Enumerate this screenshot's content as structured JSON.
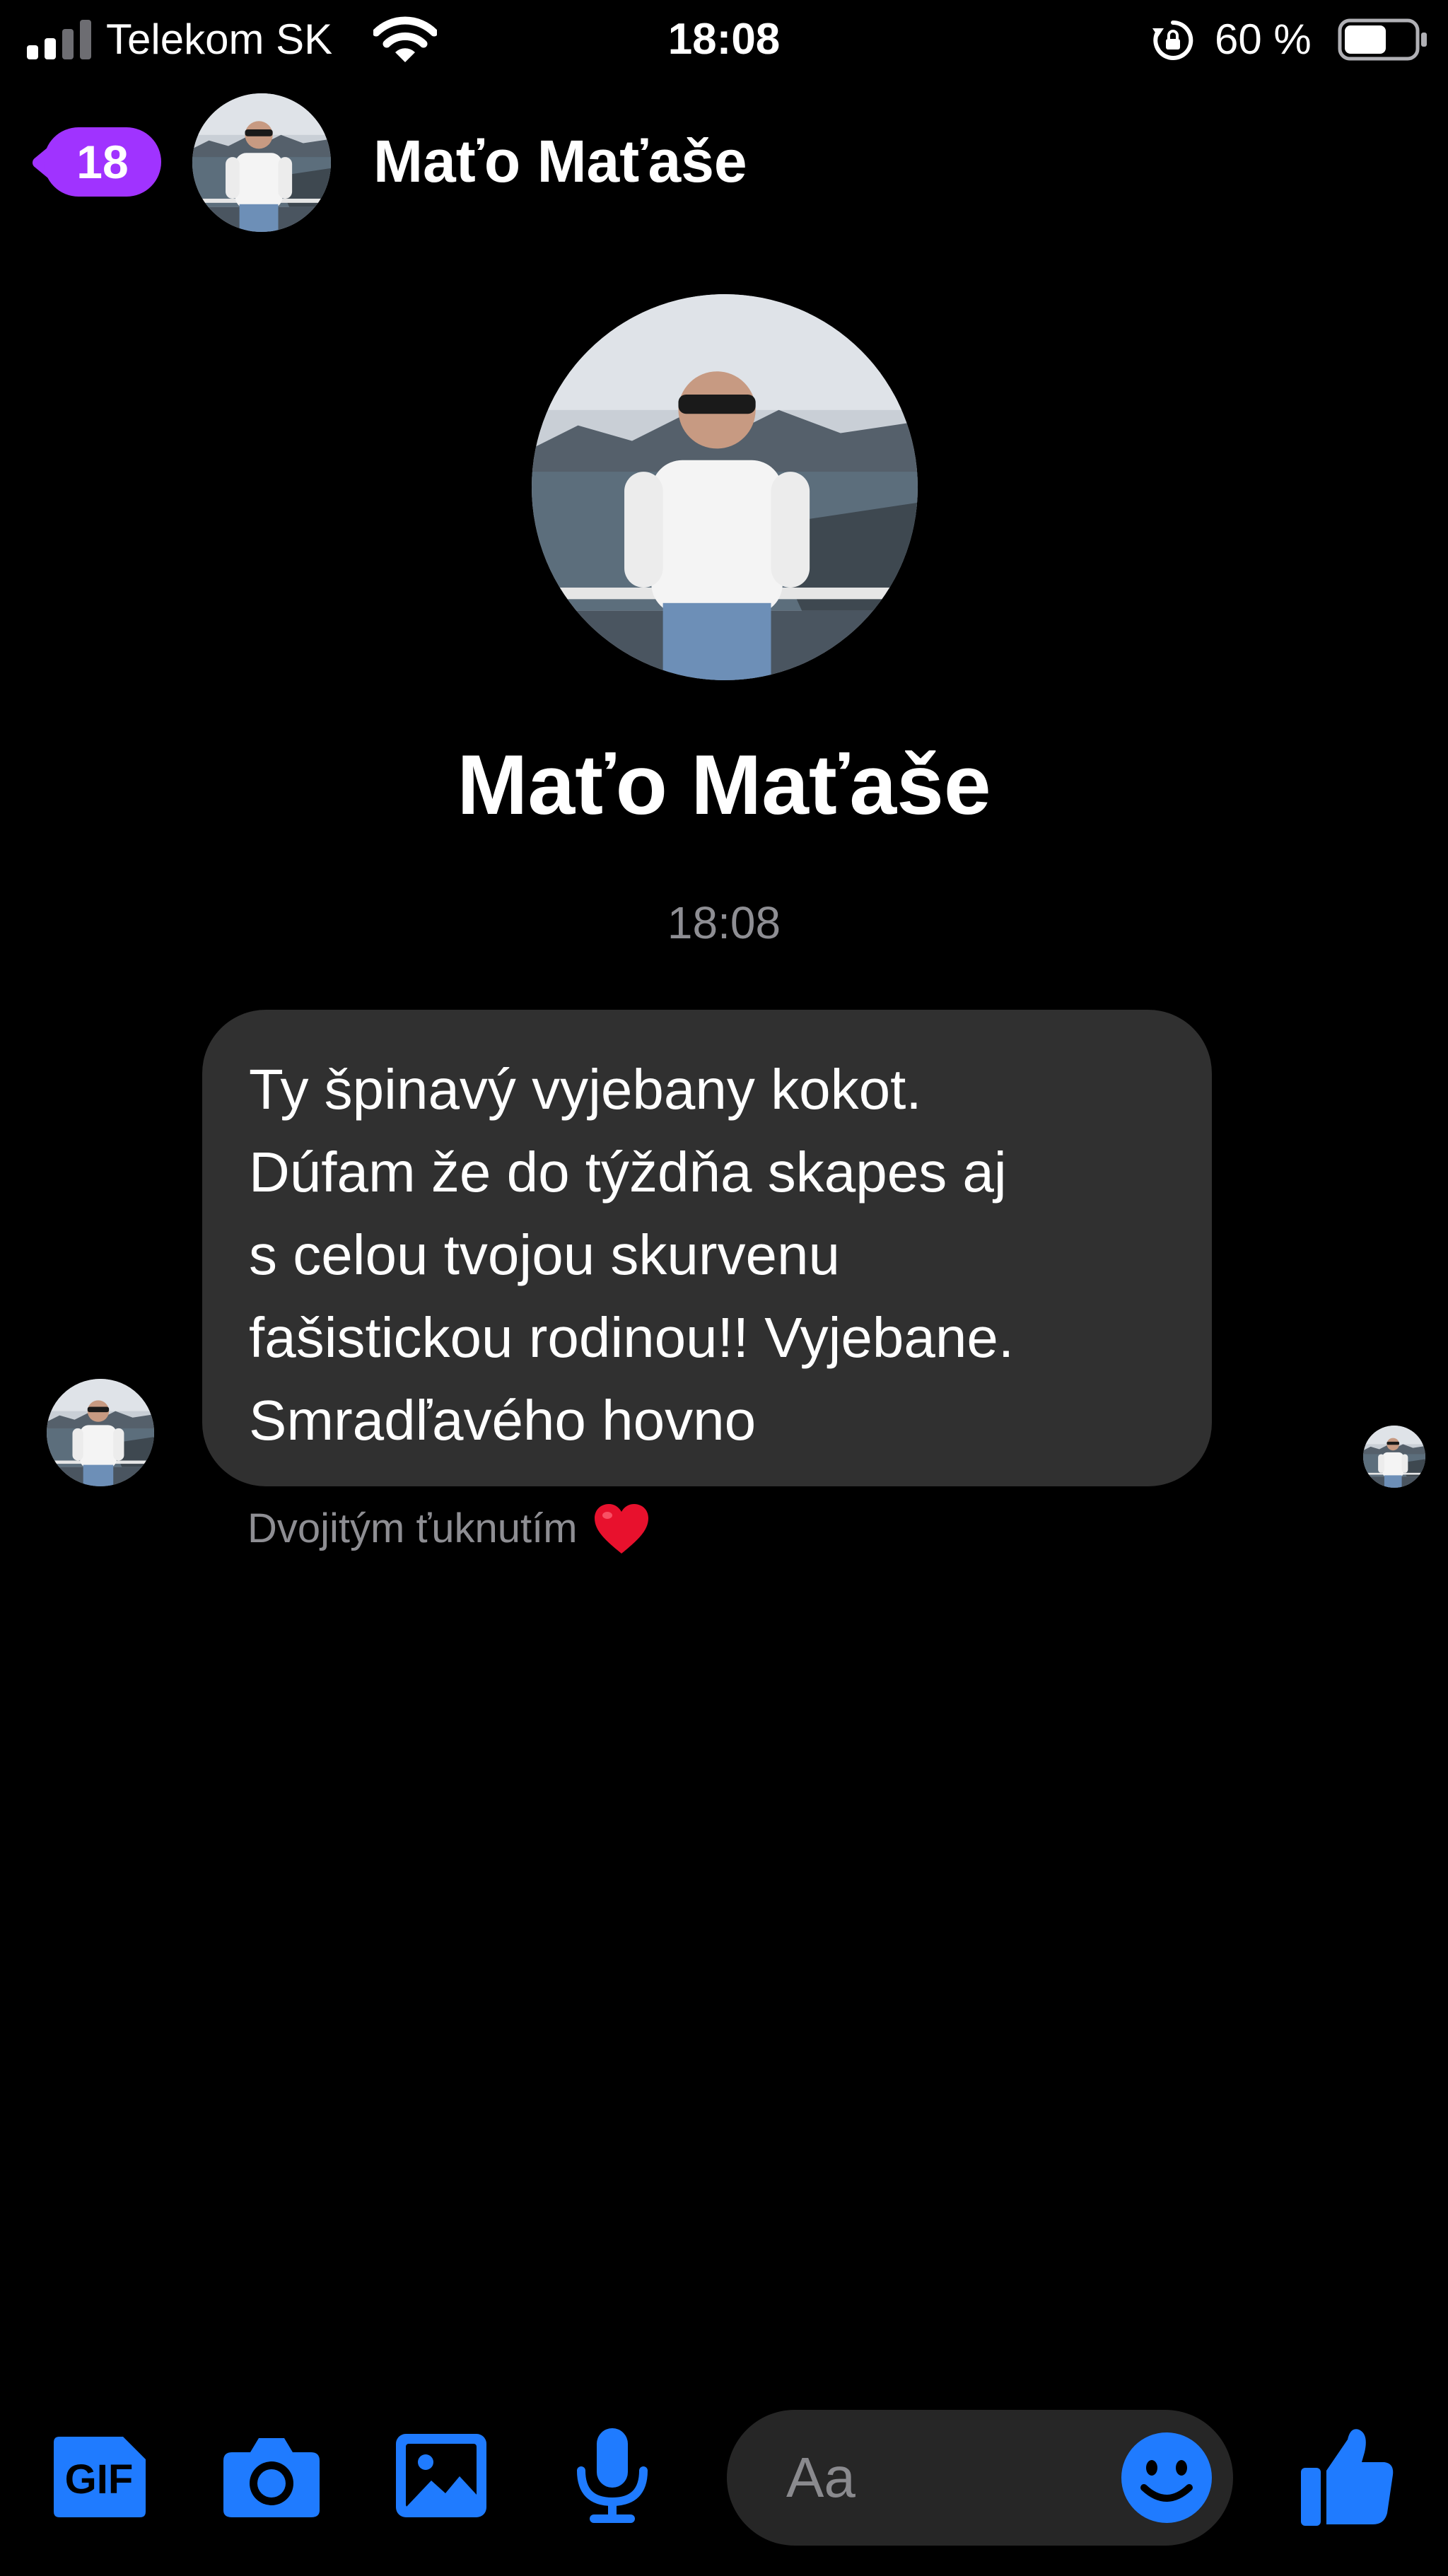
{
  "status_bar": {
    "carrier": "Telekom SK",
    "time": "18:08",
    "battery_percent": "60 %",
    "battery_level": 0.6,
    "signal_bars_filled": 2,
    "signal_bars_total": 4,
    "icons": [
      "signal-icon",
      "wifi-icon",
      "rotation-lock-icon",
      "battery-icon"
    ]
  },
  "header": {
    "back_icon": "chevron-left-icon",
    "unread_count": "18",
    "contact_name": "Maťo Maťaše"
  },
  "profile": {
    "name": "Maťo Maťaše"
  },
  "conversation": {
    "timestamp": "18:08",
    "messages": [
      {
        "direction": "incoming",
        "text": "Ty špinavý vyjebany kokot.\nDúfam že do týždňa skapes aj\ns celou tvojou skurvenu\nfašistickou rodinou!! Vyjebane.\nSmradľavého hovno"
      }
    ],
    "reaction_hint": "Dvojitým ťuknutím",
    "reaction_icon": "heart-icon"
  },
  "composer": {
    "placeholder": "Aa",
    "gif_label": "GIF",
    "icons": [
      "gif-icon",
      "camera-icon",
      "image-icon",
      "microphone-icon",
      "emoji-icon",
      "thumbs-up-icon"
    ]
  },
  "colors": {
    "background": "#000000",
    "accent_blue": "#1f7bff",
    "badge_purple": "#a033ff",
    "bubble": "#303030",
    "secondary_text": "#8e8e93",
    "heart": "#e8112d"
  }
}
